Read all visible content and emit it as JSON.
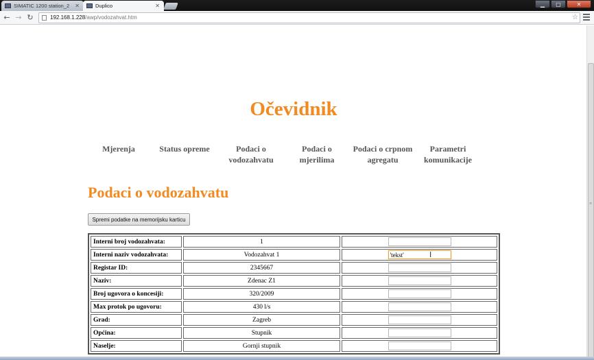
{
  "browser": {
    "tabs": [
      {
        "label": "SIMATIC 1200 station_2"
      },
      {
        "label": "Duplico"
      }
    ],
    "url": {
      "host": "192.168.1.228",
      "path": "/awp/vodozahvat.htm"
    },
    "icons": {
      "back": "back-arrow-icon",
      "forward": "forward-arrow-icon",
      "reload": "reload-icon",
      "bookmark": "star-icon",
      "menu": "menu-icon",
      "close": "close-icon"
    }
  },
  "page": {
    "title": "Očevidnik",
    "nav": [
      {
        "label": "Mjerenja"
      },
      {
        "label": "Status opreme"
      },
      {
        "label": "Podaci o vodozahvatu"
      },
      {
        "label": "Podaci o mjerilima"
      },
      {
        "label": "Podaci o crpnom agregatu"
      },
      {
        "label": "Parametri komunikacije"
      }
    ],
    "section_title": "Podaci o vodozahvatu",
    "save_button": "Spremi podatke na memorijsku karticu",
    "rows": [
      {
        "label": "Interni broj vodozahvata:",
        "value": "1",
        "input": ""
      },
      {
        "label": "Interni naziv vodozahvata:",
        "value": "Vodozahvat 1",
        "input": "'tekst'"
      },
      {
        "label": "Registar ID:",
        "value": "2345667",
        "input": ""
      },
      {
        "label": "Naziv:",
        "value": "Zdenac Z1",
        "input": ""
      },
      {
        "label": "Broj ugovora o koncesiji:",
        "value": "320/2009",
        "input": ""
      },
      {
        "label": "Max protok po ugovoru:",
        "value": "430 l/s",
        "input": ""
      },
      {
        "label": "Grad:",
        "value": "Zagreb",
        "input": ""
      },
      {
        "label": "Općina:",
        "value": "Stupnik",
        "input": ""
      },
      {
        "label": "Naselje:",
        "value": "Gornji stupnik",
        "input": ""
      }
    ]
  },
  "colors": {
    "accent": "#f28a22",
    "nav_text": "#555555"
  }
}
